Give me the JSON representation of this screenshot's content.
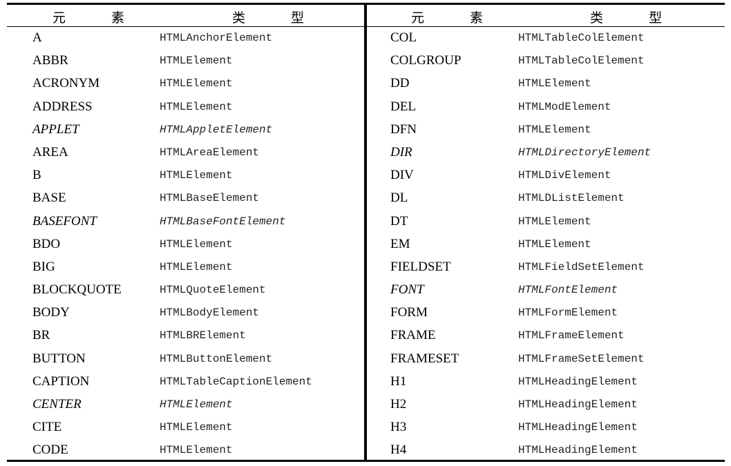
{
  "headers": {
    "element": "元 素",
    "type": "类 型"
  },
  "left_rows": [
    {
      "element": "A",
      "type": "HTMLAnchorElement",
      "italic": false
    },
    {
      "element": "ABBR",
      "type": "HTMLElement",
      "italic": false
    },
    {
      "element": "ACRONYM",
      "type": "HTMLElement",
      "italic": false
    },
    {
      "element": "ADDRESS",
      "type": "HTMLElement",
      "italic": false
    },
    {
      "element": "APPLET",
      "type": "HTMLAppletElement",
      "italic": true
    },
    {
      "element": "AREA",
      "type": "HTMLAreaElement",
      "italic": false
    },
    {
      "element": "B",
      "type": "HTMLElement",
      "italic": false
    },
    {
      "element": "BASE",
      "type": "HTMLBaseElement",
      "italic": false
    },
    {
      "element": "BASEFONT",
      "type": "HTMLBaseFontElement",
      "italic": true
    },
    {
      "element": "BDO",
      "type": "HTMLElement",
      "italic": false
    },
    {
      "element": "BIG",
      "type": "HTMLElement",
      "italic": false
    },
    {
      "element": "BLOCKQUOTE",
      "type": "HTMLQuoteElement",
      "italic": false
    },
    {
      "element": "BODY",
      "type": "HTMLBodyElement",
      "italic": false
    },
    {
      "element": "BR",
      "type": "HTMLBRElement",
      "italic": false
    },
    {
      "element": "BUTTON",
      "type": "HTMLButtonElement",
      "italic": false
    },
    {
      "element": "CAPTION",
      "type": "HTMLTableCaptionElement",
      "italic": false
    },
    {
      "element": "CENTER",
      "type": "HTMLElement",
      "italic": true
    },
    {
      "element": "CITE",
      "type": "HTMLElement",
      "italic": false
    },
    {
      "element": "CODE",
      "type": "HTMLElement",
      "italic": false
    }
  ],
  "right_rows": [
    {
      "element": "COL",
      "type": "HTMLTableColElement",
      "italic": false
    },
    {
      "element": "COLGROUP",
      "type": "HTMLTableColElement",
      "italic": false
    },
    {
      "element": "DD",
      "type": "HTMLElement",
      "italic": false
    },
    {
      "element": "DEL",
      "type": "HTMLModElement",
      "italic": false
    },
    {
      "element": "DFN",
      "type": "HTMLElement",
      "italic": false
    },
    {
      "element": "DIR",
      "type": "HTMLDirectoryElement",
      "italic": true
    },
    {
      "element": "DIV",
      "type": "HTMLDivElement",
      "italic": false
    },
    {
      "element": "DL",
      "type": "HTMLDListElement",
      "italic": false
    },
    {
      "element": "DT",
      "type": "HTMLElement",
      "italic": false
    },
    {
      "element": "EM",
      "type": "HTMLElement",
      "italic": false
    },
    {
      "element": "FIELDSET",
      "type": "HTMLFieldSetElement",
      "italic": false
    },
    {
      "element": "FONT",
      "type": "HTMLFontElement",
      "italic": true
    },
    {
      "element": "FORM",
      "type": "HTMLFormElement",
      "italic": false
    },
    {
      "element": "FRAME",
      "type": "HTMLFrameElement",
      "italic": false
    },
    {
      "element": "FRAMESET",
      "type": "HTMLFrameSetElement",
      "italic": false
    },
    {
      "element": "H1",
      "type": "HTMLHeadingElement",
      "italic": false
    },
    {
      "element": "H2",
      "type": "HTMLHeadingElement",
      "italic": false
    },
    {
      "element": "H3",
      "type": "HTMLHeadingElement",
      "italic": false
    },
    {
      "element": "H4",
      "type": "HTMLHeadingElement",
      "italic": false
    }
  ]
}
